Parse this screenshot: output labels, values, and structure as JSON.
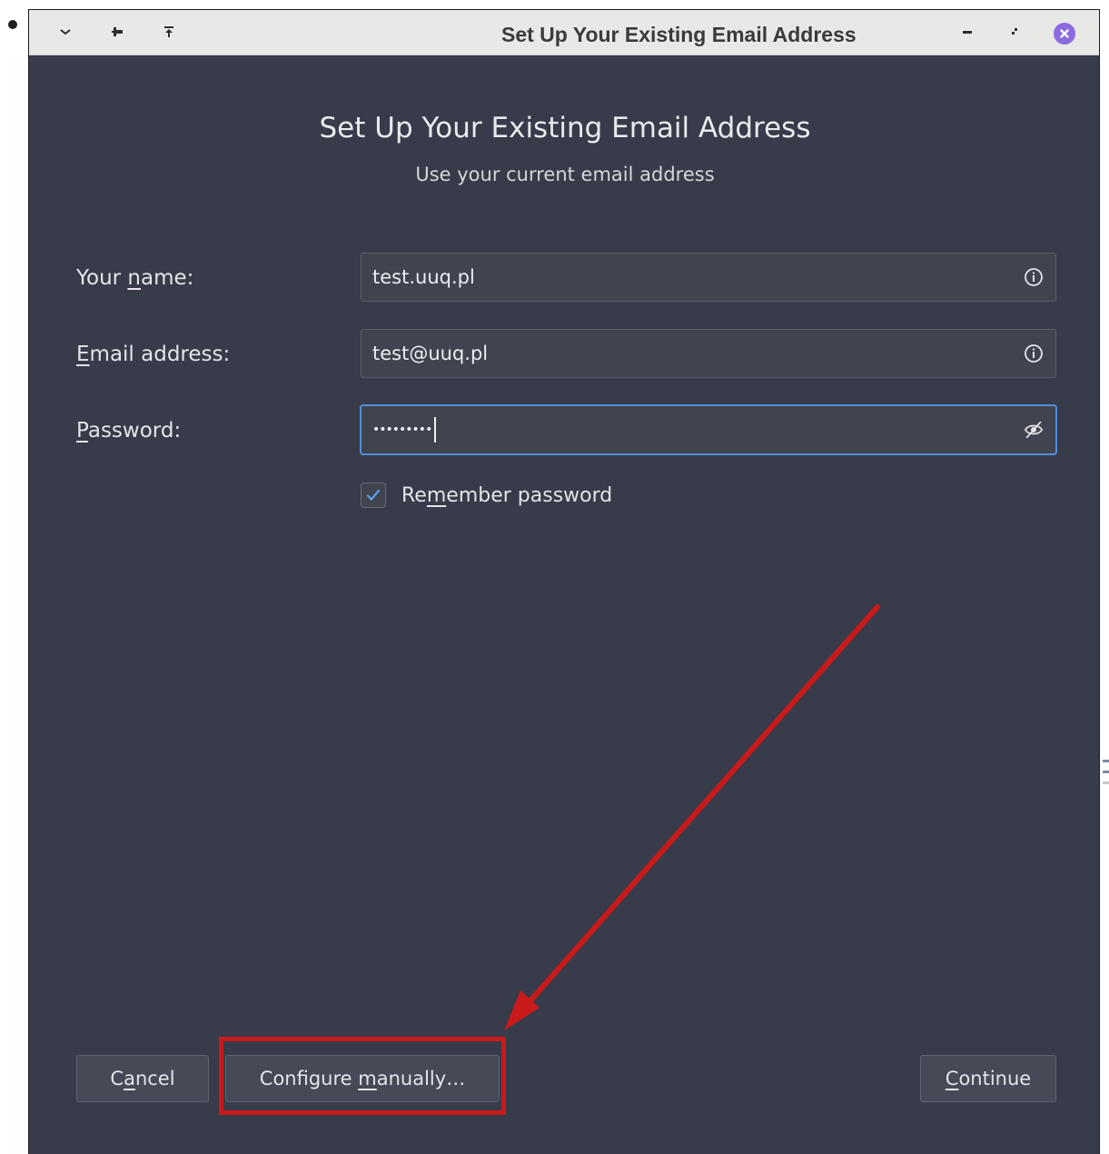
{
  "window": {
    "title": "Set Up Your Existing Email Address",
    "titlebar_icons": [
      "chevron-down-icon",
      "pin-icon",
      "keep-above-icon"
    ],
    "controls": [
      "minimize-icon",
      "maximize-icon",
      "close-icon"
    ]
  },
  "dialog": {
    "heading": "Set Up Your Existing Email Address",
    "subheading": "Use your current email address"
  },
  "form": {
    "name": {
      "label_pre": "Your ",
      "label_u": "n",
      "label_post": "ame:",
      "value": "test.uuq.pl",
      "icon": "info-icon"
    },
    "email": {
      "label_pre": "",
      "label_u": "E",
      "label_post": "mail address:",
      "value": "test@uuq.pl",
      "icon": "info-icon"
    },
    "password": {
      "label_pre": "",
      "label_u": "P",
      "label_post": "assword:",
      "masked_value": "•••••••••",
      "icon": "eye-slash-icon",
      "focused": true
    },
    "remember": {
      "checked": true,
      "label_pre": "Re",
      "label_u": "m",
      "label_post": "ember password"
    }
  },
  "buttons": {
    "cancel": {
      "pre": "C",
      "u": "a",
      "post": "ncel"
    },
    "configure": {
      "pre": "Configure ",
      "u": "m",
      "post": "anually…"
    },
    "continue": {
      "pre": "",
      "u": "C",
      "post": "ontinue"
    }
  },
  "annotation": {
    "color": "#c81a1a",
    "type": "arrow pointing to highlighted Configure manually button"
  },
  "colors": {
    "dialog_bg": "#383b49",
    "field_bg": "#41444f",
    "focus_border": "#4f8fdc",
    "checkbox_check": "#5aa0f0",
    "close_button": "#8b6be0"
  }
}
